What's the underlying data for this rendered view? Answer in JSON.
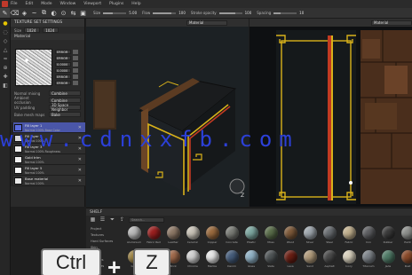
{
  "menubar": {
    "items": [
      "File",
      "Edit",
      "Mode",
      "Window",
      "Viewport",
      "Plugins",
      "Help"
    ]
  },
  "toolbar": {
    "props": [
      {
        "label": "Size",
        "value": "5.00",
        "fill": 0.4
      },
      {
        "label": "Flow",
        "value": "100",
        "fill": 0.8
      },
      {
        "label": "Stroke opacity",
        "value": "100",
        "fill": 0.7
      },
      {
        "label": "Spacing",
        "value": "10",
        "fill": 0.3
      }
    ]
  },
  "properties_panel": {
    "title": "TEXTURE SET SETTINGS",
    "resolution_label": "Size",
    "resolution_value": "1024",
    "section_material": "Material",
    "material_props": [
      "ERROR",
      "ERROR",
      "0.0000",
      "0.0000",
      "ERROR",
      "ERROR"
    ],
    "normal_mixing_label": "Normal mixing",
    "normal_mixing_value": "Combine",
    "ao_mixing_label": "Ambient occlusion",
    "uv_padding_label": "UV padding",
    "uv_padding_value": "3D Space Neighbor",
    "bake_label": "Bake mesh maps",
    "bake_value": "Bake"
  },
  "layers": [
    {
      "name": "Fill layer 1",
      "sub": "Normal  100%  Base Color",
      "selected": true,
      "thumb": "#5a6be0"
    },
    {
      "name": "Fill layer 2",
      "sub": "Normal  100%",
      "selected": false,
      "thumb": "#d9d9d9"
    },
    {
      "name": "Fill layer 3",
      "sub": "Normal  100%  Roughness",
      "selected": false,
      "thumb": "#f0f0f0"
    },
    {
      "name": "Gold trim",
      "sub": "Normal  100%",
      "selected": false,
      "thumb": "#f0f0f0"
    },
    {
      "name": "Fill layer 5",
      "sub": "Normal  100%",
      "selected": false,
      "thumb": "#f5f5f5"
    },
    {
      "name": "Base material",
      "sub": "Normal  100%",
      "selected": false,
      "thumb": "#e8e8e8"
    }
  ],
  "viewport_2d": {
    "mode_label": "Material"
  },
  "viewport_3d": {
    "mode_label": "Material"
  },
  "shelf": {
    "title": "SHELF",
    "search_placeholder": "Search...",
    "categories": [
      "Project",
      "Textures",
      "Hard Surfaces",
      "Skin",
      "Filters",
      "Brushes",
      "Particles",
      "Tools",
      "Materials",
      "Smart materials"
    ],
    "materials": [
      {
        "name": "Aluminium",
        "color": "#b9b9b9"
      },
      {
        "name": "Fabric Red",
        "color": "#9a1f1f"
      },
      {
        "name": "Leather",
        "color": "#8d7866"
      },
      {
        "name": "Ceramic",
        "color": "#c8c2b6"
      },
      {
        "name": "Copper",
        "color": "#9a6a3e"
      },
      {
        "name": "Concrete",
        "color": "#7a7c76"
      },
      {
        "name": "Plastic",
        "color": "#7da7a0"
      },
      {
        "name": "Moss",
        "color": "#5a6d4a"
      },
      {
        "name": "Wood",
        "color": "#7e5a3a"
      },
      {
        "name": "Silver",
        "color": "#9ea6ad"
      },
      {
        "name": "Steel",
        "color": "#6a6e72"
      },
      {
        "name": "Fabric",
        "color": "#c2b08e"
      },
      {
        "name": "Iron",
        "color": "#5f6063"
      },
      {
        "name": "Rubber",
        "color": "#3b3b3b"
      },
      {
        "name": "Paint",
        "color": "#8d8f8c"
      },
      {
        "name": "Gold",
        "color": "#9a8142"
      },
      {
        "name": "Bronze",
        "color": "#6c5232"
      },
      {
        "name": "Brick",
        "color": "#a06a4c"
      },
      {
        "name": "Chrome",
        "color": "#d0d0d0"
      },
      {
        "name": "Marble",
        "color": "#e6e6e6"
      },
      {
        "name": "Denim",
        "color": "#455c7a"
      },
      {
        "name": "Glass",
        "color": "#8fb0c4"
      },
      {
        "name": "Slate",
        "color": "#4f5456"
      },
      {
        "name": "Lava",
        "color": "#6a1f14"
      },
      {
        "name": "Sand",
        "color": "#b09a7a"
      },
      {
        "name": "Asphalt",
        "color": "#4a4a4a"
      },
      {
        "name": "Ivory",
        "color": "#d8d0bc"
      },
      {
        "name": "Titanium",
        "color": "#7c8288"
      },
      {
        "name": "Jade",
        "color": "#4f7a66"
      },
      {
        "name": "Rust",
        "color": "#8a4a2a"
      }
    ]
  },
  "keystroke_overlay": {
    "key1": "Ctrl",
    "key2": "Z"
  },
  "watermark_text": "www.cdnxxfb.com",
  "colors": {
    "accent_yellow": "#e5c400",
    "selection": "#4a56a8",
    "trim_gold": "#d9b21a",
    "trim_red": "#c23a22"
  }
}
